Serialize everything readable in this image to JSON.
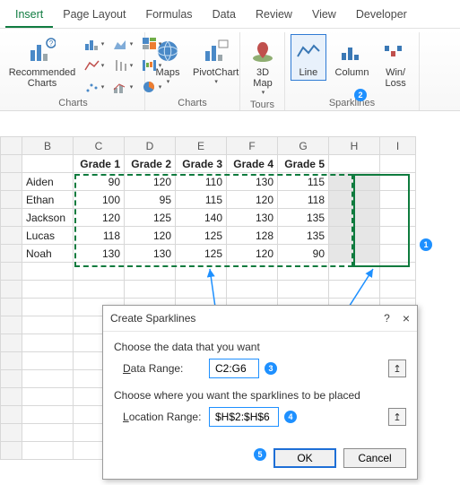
{
  "tabs": [
    "Insert",
    "Page Layout",
    "Formulas",
    "Data",
    "Review",
    "View",
    "Developer"
  ],
  "active_tab": "Insert",
  "ribbon": {
    "recommended": "Recommended\nCharts",
    "charts_label": "Charts",
    "maps": "Maps",
    "pivotchart": "PivotChart",
    "tours_label": "Tours",
    "d3map": "3D\nMap",
    "sparklines_label": "Sparklines",
    "line": "Line",
    "column": "Column",
    "winloss": "Win/\nLoss"
  },
  "columns": [
    "B",
    "C",
    "D",
    "E",
    "F",
    "G",
    "H",
    "I"
  ],
  "grade_headers": [
    "Grade 1",
    "Grade 2",
    "Grade 3",
    "Grade 4",
    "Grade 5"
  ],
  "names": [
    "Aiden",
    "Ethan",
    "Jackson",
    "Lucas",
    "Noah"
  ],
  "chart_data": {
    "type": "table",
    "rows": [
      {
        "name": "Aiden",
        "values": [
          90,
          120,
          110,
          130,
          115
        ]
      },
      {
        "name": "Ethan",
        "values": [
          100,
          95,
          115,
          120,
          118
        ]
      },
      {
        "name": "Jackson",
        "values": [
          120,
          125,
          140,
          130,
          135
        ]
      },
      {
        "name": "Lucas",
        "values": [
          118,
          120,
          125,
          128,
          135
        ]
      },
      {
        "name": "Noah",
        "values": [
          130,
          130,
          125,
          120,
          90
        ]
      }
    ]
  },
  "dialog": {
    "title": "Create Sparklines",
    "section1": "Choose the data that you want",
    "data_label_pre": "D",
    "data_label_rest": "ata Range:",
    "data_value": "C2:G6",
    "section2": "Choose where you want the sparklines to be placed",
    "loc_label_pre": "L",
    "loc_label_rest": "ocation Range:",
    "loc_value": "$H$2:$H$6",
    "ok": "OK",
    "cancel": "Cancel"
  },
  "callouts": {
    "c1": "1",
    "c2": "2",
    "c3": "3",
    "c4": "4",
    "c5": "5"
  }
}
